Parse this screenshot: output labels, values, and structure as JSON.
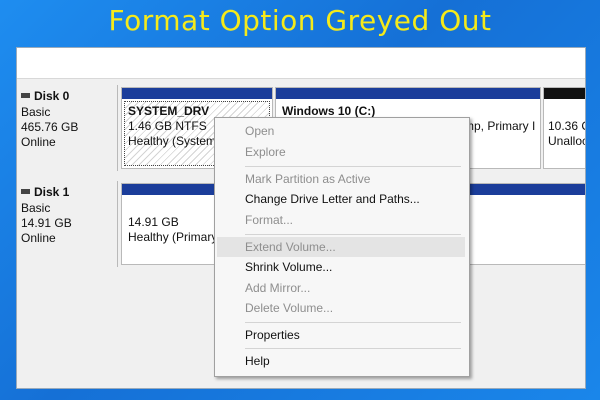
{
  "banner": {
    "title": "Format Option Greyed Out"
  },
  "disks": [
    {
      "name": "Disk 0",
      "type": "Basic",
      "size": "465.76 GB",
      "status": "Online",
      "partitions": [
        {
          "name": "SYSTEM_DRV",
          "line2": "1.46 GB NTFS",
          "line3": "Healthy (System"
        },
        {
          "name": "Windows 10  (C:)",
          "line3": "mp, Primary I"
        },
        {
          "line2": "10.36 C",
          "line3": "Unalloc"
        }
      ]
    },
    {
      "name": "Disk 1",
      "type": "Basic",
      "size": "14.91 GB",
      "status": "Online",
      "partitions": [
        {
          "line2": "14.91 GB",
          "line3": "Healthy (Primary"
        }
      ]
    }
  ],
  "context_menu": {
    "items": [
      {
        "label": "Open",
        "enabled": false
      },
      {
        "label": "Explore",
        "enabled": false
      },
      {
        "label": "Mark Partition as Active",
        "enabled": false
      },
      {
        "label": "Change Drive Letter and Paths...",
        "enabled": true
      },
      {
        "label": "Format...",
        "enabled": false
      },
      {
        "label": "Extend Volume...",
        "enabled": false,
        "highlighted": true
      },
      {
        "label": "Shrink Volume...",
        "enabled": true
      },
      {
        "label": "Add Mirror...",
        "enabled": false
      },
      {
        "label": "Delete Volume...",
        "enabled": false
      },
      {
        "label": "Properties",
        "enabled": true
      },
      {
        "label": "Help",
        "enabled": true
      }
    ]
  },
  "colors": {
    "banner_bg": "#1c7fe0",
    "title_text": "#f5ea1a",
    "partition_bar_primary": "#1b3d9a",
    "partition_bar_unallocated": "#111111",
    "disabled_text": "#8e8e8e"
  }
}
